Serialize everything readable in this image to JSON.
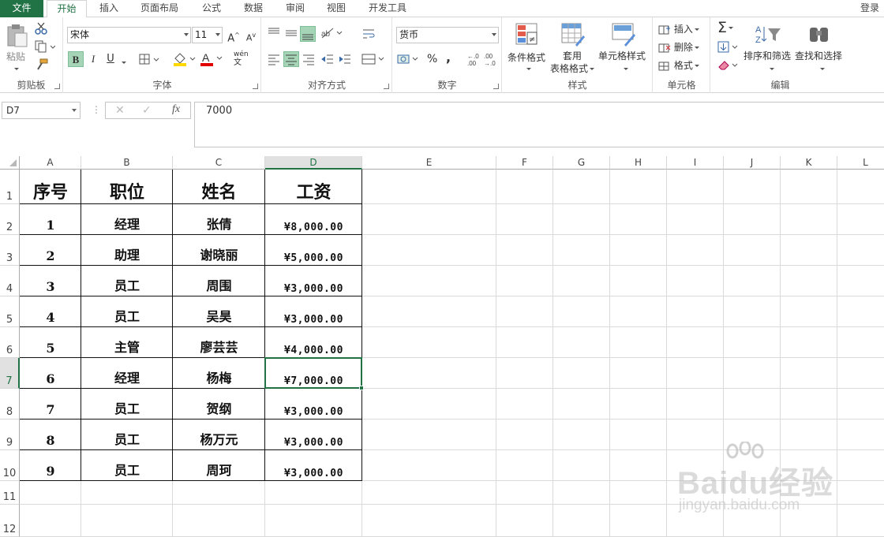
{
  "tabs": {
    "file": "文件",
    "home": "开始",
    "insert": "插入",
    "page_layout": "页面布局",
    "formulas": "公式",
    "data": "数据",
    "review": "审阅",
    "view": "视图",
    "developer": "开发工具"
  },
  "login": "登录",
  "ribbon": {
    "clipboard": {
      "label": "剪贴板",
      "paste": "粘贴"
    },
    "font": {
      "label": "字体",
      "font_name": "宋体",
      "font_size": "11",
      "bold": "B",
      "italic": "I",
      "underline": "U",
      "grow": "A",
      "shrink": "A",
      "font_color_letter": "A",
      "wen": "wén",
      "wen_char": "文"
    },
    "alignment": {
      "label": "对齐方式"
    },
    "number": {
      "label": "数字",
      "format": "货币",
      "percent": "%",
      "comma": ",",
      "inc_dec": ".0\n.00",
      "dec_dec": ".00\n→.0"
    },
    "styles": {
      "label": "样式",
      "conditional": "条件格式",
      "table_format_1": "套用",
      "table_format_2": "表格格式",
      "cell_styles": "单元格样式"
    },
    "cells": {
      "label": "单元格",
      "insert": "插入",
      "delete": "删除",
      "format": "格式"
    },
    "editing": {
      "label": "编辑",
      "sort_filter": "排序和筛选",
      "find_select": "查找和选择",
      "sigma": "Σ"
    }
  },
  "formula_bar": {
    "name_box": "D7",
    "cancel": "✕",
    "enter": "✓",
    "fx": "fx",
    "content": "7000"
  },
  "grid": {
    "columns": [
      "A",
      "B",
      "C",
      "D",
      "E",
      "F",
      "G",
      "H",
      "I",
      "J",
      "K",
      "L"
    ],
    "rows": [
      "1",
      "2",
      "3",
      "4",
      "5",
      "6",
      "7",
      "8",
      "9",
      "10",
      "11",
      "12"
    ],
    "selected_column": "D",
    "selected_row": "7",
    "header": [
      "序号",
      "职位",
      "姓名",
      "工资"
    ],
    "data": [
      [
        "1",
        "经理",
        "张倩",
        "¥8,000.00"
      ],
      [
        "2",
        "助理",
        "谢晓丽",
        "¥5,000.00"
      ],
      [
        "3",
        "员工",
        "周围",
        "¥3,000.00"
      ],
      [
        "4",
        "员工",
        "吴昊",
        "¥3,000.00"
      ],
      [
        "5",
        "主管",
        "廖芸芸",
        "¥4,000.00"
      ],
      [
        "6",
        "经理",
        "杨梅",
        "¥7,000.00"
      ],
      [
        "7",
        "员工",
        "贺纲",
        "¥3,000.00"
      ],
      [
        "8",
        "员工",
        "杨万元",
        "¥3,000.00"
      ],
      [
        "9",
        "员工",
        "周珂",
        "¥3,000.00"
      ]
    ]
  },
  "watermark": {
    "brand": "Baidu经验",
    "url": "jingyan.baidu.com"
  },
  "colors": {
    "accent": "#217346",
    "selected_header_bg": "#e1e1e1",
    "button_active": "#a5d4b6"
  }
}
